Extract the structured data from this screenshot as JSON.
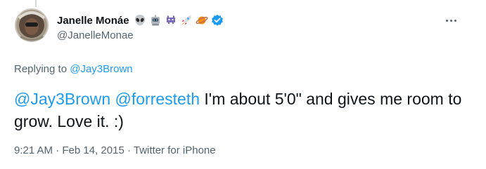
{
  "tweet": {
    "author": {
      "display_name": "Janelle Monáe",
      "handle": "@JanelleMonae",
      "verified": true,
      "name_emojis": [
        "alien-emoji",
        "robot-emoji",
        "space-invader-emoji",
        "rocket-emoji",
        "planet-emoji"
      ]
    },
    "replying_to": {
      "prefix": "Replying to",
      "handle": "@Jay3Brown"
    },
    "text": {
      "mention_1": "@Jay3Brown",
      "mention_2": "@forresteth",
      "body": "I'm about 5'0\" and gives me room to grow. Love it. :)"
    },
    "meta": {
      "time": "9:21 AM",
      "separator": "·",
      "date": "Feb 14, 2015",
      "source": "Twitter for iPhone"
    }
  },
  "colors": {
    "link": "#1d9bf0",
    "secondary_text": "#536471",
    "primary_text": "#0f1419",
    "verified_badge": "#1d9bf0"
  }
}
